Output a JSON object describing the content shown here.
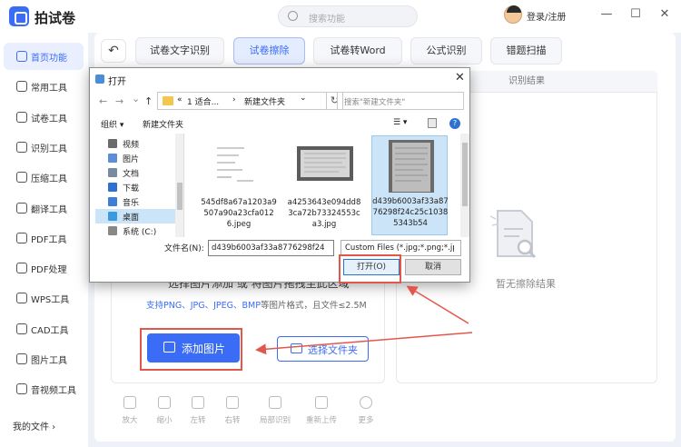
{
  "app": {
    "title": "拍试卷",
    "search_placeholder": "搜索功能",
    "login": "登录/注册",
    "window_buttons": [
      "—",
      "☐",
      "✕"
    ]
  },
  "sidebar": {
    "items": [
      {
        "label": "首页功能",
        "icon": "home-icon",
        "active": true
      },
      {
        "label": "常用工具",
        "icon": "layers-icon"
      },
      {
        "label": "试卷工具",
        "icon": "paper-icon"
      },
      {
        "label": "识别工具",
        "icon": "scan-icon"
      },
      {
        "label": "压缩工具",
        "icon": "compress-icon"
      },
      {
        "label": "翻译工具",
        "icon": "translate-icon"
      },
      {
        "label": "PDF工具",
        "icon": "pdf-icon"
      },
      {
        "label": "PDF处理",
        "icon": "pdf-process-icon"
      },
      {
        "label": "WPS工具",
        "icon": "wps-icon"
      },
      {
        "label": "CAD工具",
        "icon": "cad-icon"
      },
      {
        "label": "图片工具",
        "icon": "image-icon"
      },
      {
        "label": "音视频工具",
        "icon": "media-icon"
      }
    ],
    "my_files": "我的文件 ›"
  },
  "tabs": [
    {
      "label": "试卷文字识别"
    },
    {
      "label": "试卷擦除",
      "active": true
    },
    {
      "label": "试卷转Word"
    },
    {
      "label": "公式识别"
    },
    {
      "label": "错题扫描"
    }
  ],
  "back_label": "↶",
  "left_panel": {
    "drop_text": "选择图片添加 或 将图片拖拽至此区域",
    "format_hint_prefix": "支持PNG、JPG、JPEG、BMP",
    "format_hint_suffix": "等图片格式，且文件≤2.5M",
    "add_button": "添加图片",
    "select_folder_button": "选择文件夹"
  },
  "right_panel": {
    "header": "识别结果",
    "empty_text": "暂无擦除结果"
  },
  "toolbar": [
    {
      "label": "放大",
      "icon": "zoom-in-icon"
    },
    {
      "label": "缩小",
      "icon": "zoom-out-icon"
    },
    {
      "label": "左转",
      "icon": "rotate-left-icon"
    },
    {
      "label": "右转",
      "icon": "rotate-right-icon"
    },
    {
      "label": "局部识别",
      "icon": "partial-icon"
    },
    {
      "label": "重新上传",
      "icon": "reupload-icon"
    },
    {
      "label": "更多",
      "icon": "more-icon"
    }
  ],
  "dialog": {
    "title": "打开",
    "close": "✕",
    "nav": {
      "back": "←",
      "forward": "→",
      "dropdown": "⌄",
      "up": "↑"
    },
    "address": {
      "prefix": "«",
      "crumb1": "1 适合...",
      "sep": "›",
      "crumb2": "新建文件夹",
      "dropdown": "⌄",
      "refresh": "↻"
    },
    "search_placeholder": "搜索\"新建文件夹\"",
    "commands": {
      "organize": "组织 ▾",
      "new_folder": "新建文件夹",
      "view": "☰ ▾",
      "help": "?"
    },
    "tree": [
      {
        "label": "视频",
        "color": "#6b6b6b"
      },
      {
        "label": "图片",
        "color": "#5a8fd8"
      },
      {
        "label": "文档",
        "color": "#7a8aa0"
      },
      {
        "label": "下载",
        "color": "#2d72d2"
      },
      {
        "label": "音乐",
        "color": "#3b7fd8"
      },
      {
        "label": "桌面",
        "color": "#3a9ae0",
        "selected": true
      },
      {
        "label": "系统 (C:)",
        "color": "#888"
      }
    ],
    "files": [
      {
        "name": "545df8a67a1203a9507a90a23cfa0126.jpeg",
        "thumb": "formula"
      },
      {
        "name": "a4253643e094dd83ca72b73324553ca3.jpg",
        "thumb": "photo"
      },
      {
        "name": "d439b6003af33a8776298f24c25c10385343b54",
        "thumb": "photo2",
        "selected": true
      }
    ],
    "filename_label": "文件名(N):",
    "filename_value": "d439b6003af33a8776298f24c25",
    "filetype": "Custom Files (*.jpg;*.png;*.jp",
    "open_button": "打开(O)",
    "cancel_button": "取消"
  },
  "colors": {
    "accent": "#3b6cf5",
    "annotation": "#e2574c"
  }
}
